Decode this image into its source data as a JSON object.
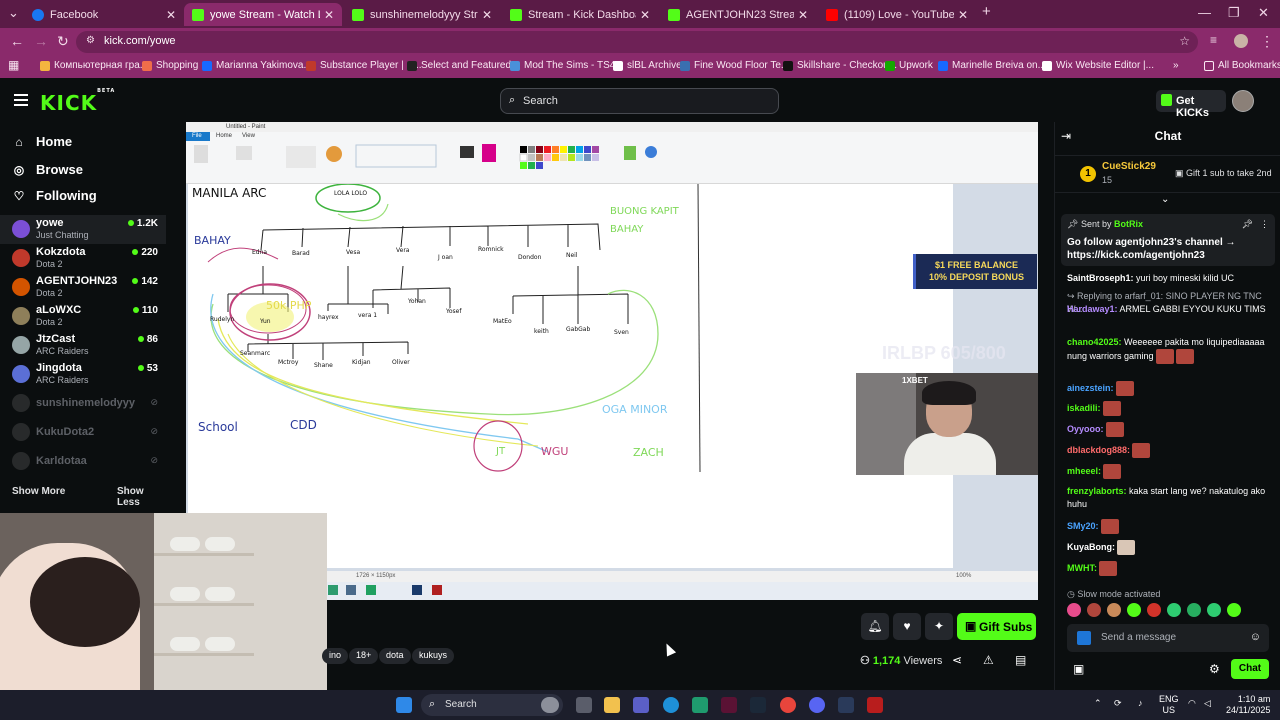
{
  "browser": {
    "tabs": [
      {
        "title": "Facebook",
        "color": "#1877f2"
      },
      {
        "title": "yowe Stream - Watch Live o",
        "color": "#53fc18",
        "active": true
      },
      {
        "title": "sunshinemelodyyy Stream - W",
        "color": "#53fc18"
      },
      {
        "title": "Stream - Kick Dashboard",
        "color": "#53fc18"
      },
      {
        "title": "AGENTJOHN23 Stream - Watch",
        "color": "#53fc18"
      },
      {
        "title": "(1109) Love - YouTube",
        "color": "#ff0000"
      }
    ],
    "new_tab": "+",
    "url": "kick.com/yowe",
    "bookmarks": [
      {
        "label": "Компьютерная гра...",
        "color": "#f3b53f"
      },
      {
        "label": "Shopping",
        "color": "#f06d4a"
      },
      {
        "label": "Marianna Yakimova...",
        "color": "#1769ff"
      },
      {
        "label": "Substance Player | S...",
        "color": "#c0392b"
      },
      {
        "label": "Select and Featured...",
        "color": "#222222"
      },
      {
        "label": "Mod The Sims - TS4...",
        "color": "#4a90d9"
      },
      {
        "label": "slBL Archive",
        "color": "#ffffff"
      },
      {
        "label": "Fine Wood Floor Te...",
        "color": "#3a6fb0"
      },
      {
        "label": "Skillshare - Checkou...",
        "color": "#111111"
      },
      {
        "label": "Upwork",
        "color": "#14a800"
      },
      {
        "label": "Marinelle Breiva on...",
        "color": "#1769ff"
      },
      {
        "label": "Wix Website Editor |...",
        "color": "#ffffff"
      }
    ],
    "all_bookmarks": "All Bookmarks"
  },
  "kick": {
    "logo": "KICK",
    "logo_badge": "BETA",
    "search_placeholder": "Search",
    "get_kicks": "Get KICKs"
  },
  "sidebar": {
    "nav": [
      {
        "label": "Home",
        "icon": "home-icon"
      },
      {
        "label": "Browse",
        "icon": "compass-icon"
      },
      {
        "label": "Following",
        "icon": "heart-icon"
      }
    ],
    "channels": [
      {
        "name": "yowe",
        "category": "Just Chatting",
        "viewers": "1.2K",
        "color": "#7b4fd6",
        "selected": true
      },
      {
        "name": "Kokzdota",
        "category": "Dota 2",
        "viewers": "220",
        "color": "#c0392b"
      },
      {
        "name": "AGENTJOHN23",
        "category": "Dota 2",
        "viewers": "142",
        "color": "#d35400"
      },
      {
        "name": "aLoWXC",
        "category": "Dota 2",
        "viewers": "110",
        "color": "#8e7f5a"
      },
      {
        "name": "JtzCast",
        "category": "ARC Raiders",
        "viewers": "86",
        "color": "#95a5a6"
      },
      {
        "name": "Jingdota",
        "category": "ARC Raiders",
        "viewers": "53",
        "color": "#5b6fd6"
      }
    ],
    "offline": [
      {
        "name": "sunshinemelodyyy"
      },
      {
        "name": "KukuDota2"
      },
      {
        "name": "Karldotaa"
      }
    ],
    "show_more": "Show More",
    "show_less": "Show Less"
  },
  "stream": {
    "paint": {
      "title_bar": "Untitled - Paint",
      "file_tab": "File",
      "ribbon_tabs": [
        "Home",
        "View"
      ],
      "status": "1726 × 1150px",
      "zoom": "100%",
      "labels": {
        "manila_arc": "MANILA ARC",
        "lola_lolo": "LOLA LOLO",
        "bahay": "BAHAY",
        "buong_kapit_1": "BUONG KAPIT",
        "buong_kapit_2": "BAHAY",
        "edna": "Edna",
        "barad": "Barad",
        "vesa": "Vesa",
        "vera": "Vera",
        "joan": "J oan",
        "romnick": "Romnick",
        "dondon": "Dondon",
        "neil": "Neil",
        "rudelyn": "Rudelyn",
        "yun": "Yun",
        "hayrex": "hayrex",
        "vera1": "vera 1",
        "yohan": "Yohan",
        "yosef": "Yosef",
        "mateo": "MatEo",
        "keith": "keith",
        "gabgab": "GabGab",
        "sven": "Sven",
        "seanmarc": "Seanmarc",
        "mctroy": "Mctroy",
        "shane": "Shane",
        "kidjan": "Kidjan",
        "oliver": "Oliver",
        "php": "50k PHP",
        "school": "School",
        "cdd": "CDD",
        "oga_minor": "OGA MINOR",
        "jt": "JT",
        "wgu": "WGU",
        "zach": "ZACH"
      }
    },
    "promo_line1": "$1 FREE BALANCE",
    "promo_line2": "10% DEPOSIT BONUS",
    "overlay_goal": "IRLBP 605/800",
    "cam_brand": "1XBET",
    "tags": [
      "ino",
      "18+",
      "dota",
      "kukuys"
    ],
    "viewers": "1,174",
    "viewers_label": "Viewers",
    "gift_subs": "Gift Subs"
  },
  "chat": {
    "title": "Chat",
    "top_gifter": {
      "rank": "1",
      "name": "CueStick29",
      "count": "15",
      "text": "Gift 1 sub to take 2nd"
    },
    "pinned": {
      "by_label": "Sent by",
      "by_name": "BotRix",
      "message": "Go follow agentjohn23's channel → https://kick.com/agentjohn23"
    },
    "messages": [
      {
        "user": "SaintBroseph1:",
        "color": "#ffffff",
        "text": "yuri boy mineski kilid UC"
      },
      {
        "user": "Replying to arfarf_01: SINO PLAYER NG TNC W...",
        "color": "#adb1b8",
        "text": "",
        "reply": true
      },
      {
        "user": "Hardaway1:",
        "color": "#b58cff",
        "text": "ARMEL GABBI EYYOU KUKU TIMS"
      },
      {
        "user": "chano42025:",
        "color": "#53fc18",
        "text": "Weeeeee pakita mo liquipediaaaaa nung warriors gaming"
      },
      {
        "user": "ainezstein:",
        "color": "#4aa3ff",
        "text": ""
      },
      {
        "user": "iskadili:",
        "color": "#53fc18",
        "text": ""
      },
      {
        "user": "Oyyooo:",
        "color": "#b58cff",
        "text": ""
      },
      {
        "user": "dblackdog888:",
        "color": "#ff6b6b",
        "text": ""
      },
      {
        "user": "mheeel:",
        "color": "#53fc18",
        "text": ""
      },
      {
        "user": "frenzylaborts:",
        "color": "#53fc18",
        "text": "kaka start lang we? nakatulog ako huhu"
      },
      {
        "user": "SMy20:",
        "color": "#4aa3ff",
        "text": ""
      },
      {
        "user": "KuyaBong:",
        "color": "#ffffff",
        "text": ""
      },
      {
        "user": "MWHT:",
        "color": "#53fc18",
        "text": ""
      }
    ],
    "slow_mode": "Slow mode activated",
    "placeholder": "Send a message",
    "send_button": "Chat"
  },
  "taskbar": {
    "search": "Search",
    "lang_1": "ENG",
    "lang_2": "US",
    "time": "1:10 am",
    "date": "24/11/2025"
  }
}
